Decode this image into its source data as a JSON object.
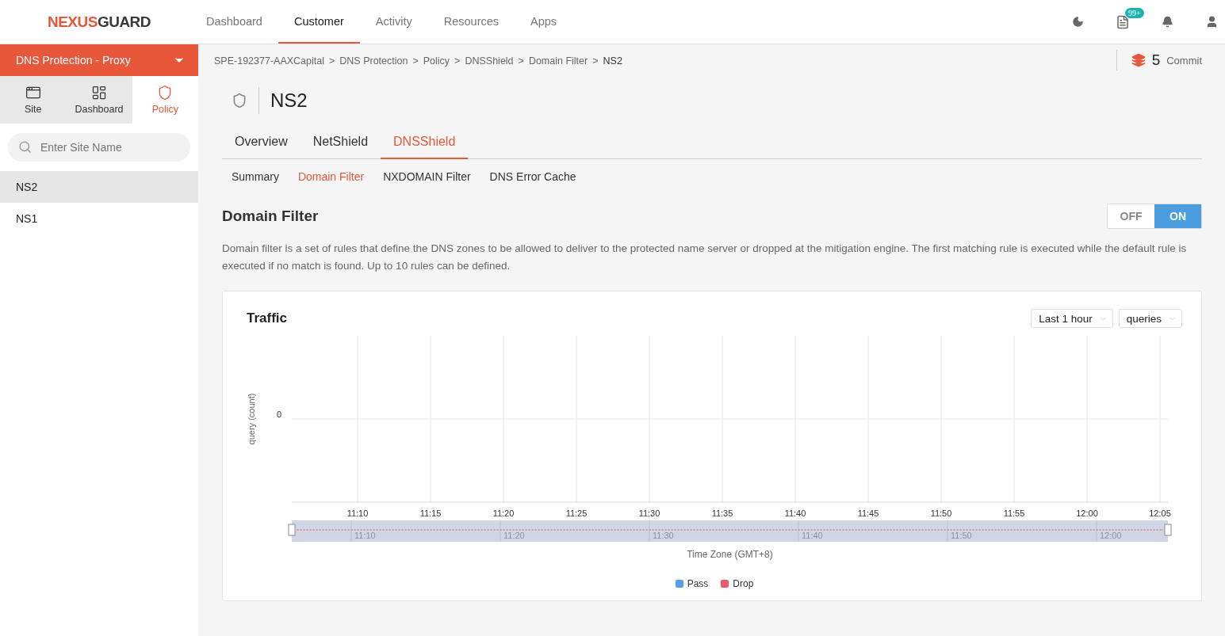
{
  "logo": {
    "parts": [
      {
        "text": "NEXUS",
        "color": "#e8573a"
      },
      {
        "text": "GUARD",
        "color": "#3a3a3a"
      }
    ]
  },
  "nav": [
    {
      "label": "Dashboard",
      "selected": false
    },
    {
      "label": "Customer",
      "selected": true
    },
    {
      "label": "Activity",
      "selected": false
    },
    {
      "label": "Resources",
      "selected": false
    },
    {
      "label": "Apps",
      "selected": false
    }
  ],
  "header_icons": {
    "badge": "99+"
  },
  "sidebar": {
    "product": "DNS Protection - Proxy",
    "modes": [
      {
        "label": "Site",
        "kind": "site",
        "selected": false
      },
      {
        "label": "Dashboard",
        "kind": "dashboard",
        "selected": false
      },
      {
        "label": "Policy",
        "kind": "policy",
        "selected": true
      }
    ],
    "search": {
      "placeholder": "Enter Site Name"
    },
    "items": [
      {
        "label": "NS2",
        "selected": true
      },
      {
        "label": "NS1",
        "selected": false
      }
    ]
  },
  "breadcrumb": {
    "separator": ">",
    "items": [
      "SPE-192377-AAXCapital",
      "DNS Protection",
      "Policy",
      "DNSShield",
      "Domain Filter",
      "NS2"
    ]
  },
  "commit": {
    "count": "5",
    "label": "Commit"
  },
  "title": "NS2",
  "tabs": [
    {
      "label": "Overview",
      "selected": false
    },
    {
      "label": "NetShield",
      "selected": false
    },
    {
      "label": "DNSShield",
      "selected": true
    }
  ],
  "subtabs": [
    {
      "label": "Summary",
      "selected": false
    },
    {
      "label": "Domain Filter",
      "selected": true
    },
    {
      "label": "NXDOMAIN Filter",
      "selected": false
    },
    {
      "label": "DNS Error Cache",
      "selected": false
    }
  ],
  "section": {
    "title": "Domain Filter",
    "toggle": [
      {
        "label": "OFF",
        "selected": false
      },
      {
        "label": "ON",
        "selected": true
      }
    ],
    "description": "Domain filter is a set of rules that define the DNS zones to be allowed to deliver to the protected name server or dropped at the mitigation engine. The first matching rule is executed while the default rule is executed if no match is found. Up to 10 rules can be defined."
  },
  "traffic": {
    "title": "Traffic",
    "range": "Last 1 hour",
    "metric": "queries",
    "ylabel": "query (count)",
    "ytick": "0",
    "xticks": [
      "11:10",
      "11:15",
      "11:20",
      "11:25",
      "11:30",
      "11:35",
      "11:40",
      "11:45",
      "11:50",
      "11:55",
      "12:00",
      "12:05"
    ],
    "zoom_ticks": [
      "11:10",
      "11:20",
      "11:30",
      "11:40",
      "11:50",
      "12:00"
    ],
    "xlabel": "Time Zone (GMT+8)",
    "zoom": {
      "level": 1
    },
    "legend": [
      {
        "label": "Pass",
        "color": "#5a9ee8"
      },
      {
        "label": "Drop",
        "color": "#ec5a6a"
      }
    ]
  }
}
